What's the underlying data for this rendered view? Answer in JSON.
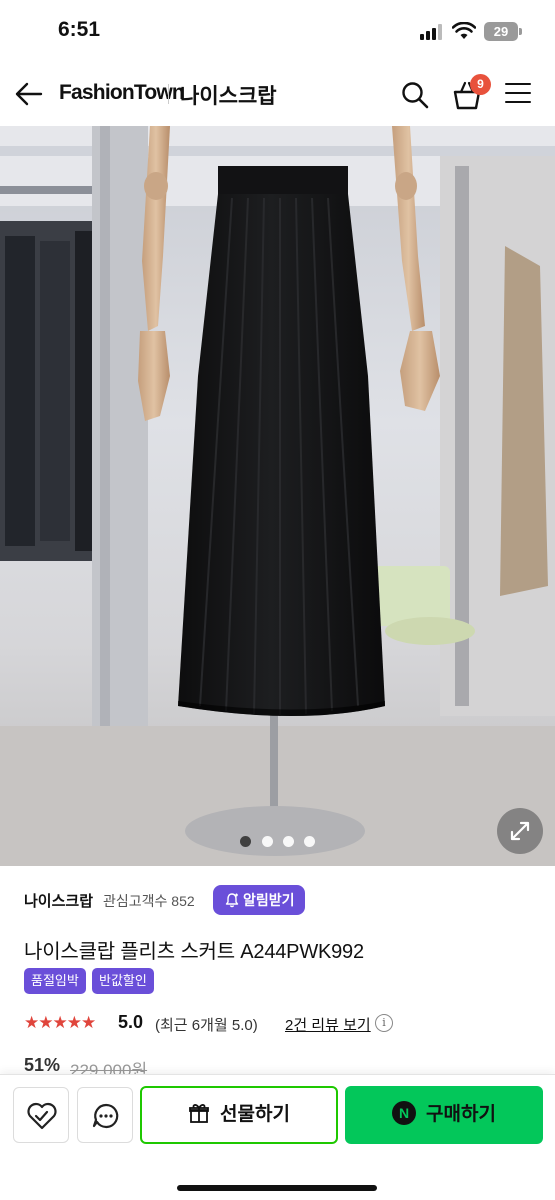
{
  "status_bar": {
    "time": "6:51",
    "battery": "29"
  },
  "header": {
    "brand": "FashionTown",
    "store_name": "나이스크랍",
    "cart_count": "9"
  },
  "gallery": {
    "slide_count": 4,
    "active_index": 0
  },
  "store": {
    "name": "나이스크랍",
    "followers_label": "관심고객수 852",
    "alarm_button": "알림받기"
  },
  "product": {
    "title": "나이스클랍 플리츠 스커트 A244PWK992",
    "badges": [
      "품절임박",
      "반값할인"
    ],
    "rating_stars": "★★★★★",
    "rating": "5.0",
    "rating_recent": "(최근 6개월 5.0)",
    "review_link": "2건 리뷰 보기",
    "discount": "51%",
    "original_price": "229,000원"
  },
  "actions": {
    "gift_label": "선물하기",
    "buy_label": "구매하기",
    "buy_logo": "N"
  },
  "colors": {
    "accent_purple": "#6a4fd9",
    "naver_green": "#03c75a",
    "star_red": "#e0453c",
    "badge_red": "#e8523c"
  }
}
